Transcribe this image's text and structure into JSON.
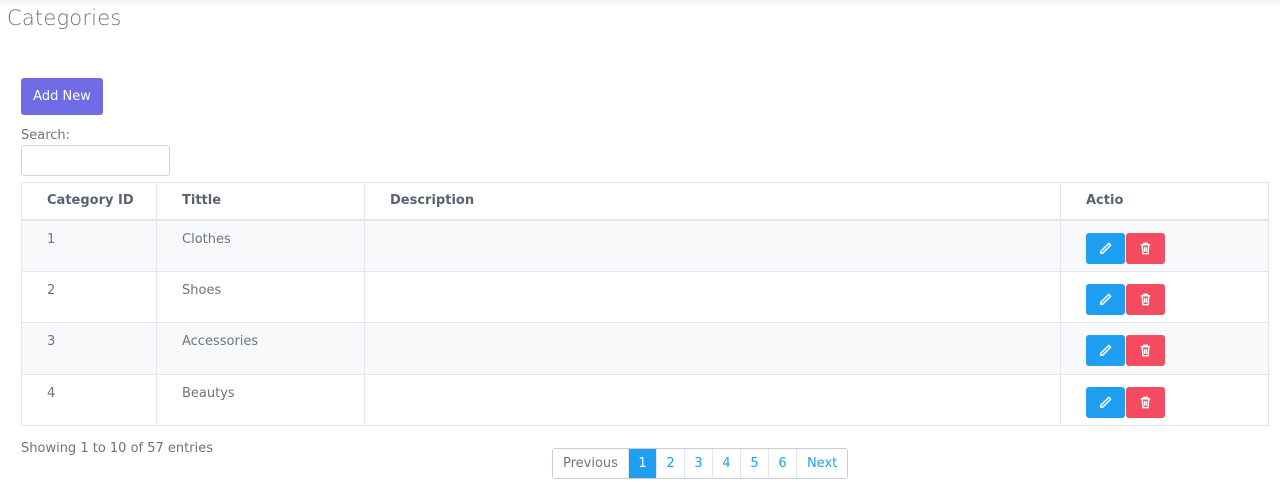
{
  "page": {
    "title": "Categories"
  },
  "toolbar": {
    "add_label": "Add New"
  },
  "search": {
    "label": "Search:",
    "value": "",
    "placeholder": ""
  },
  "table": {
    "headers": [
      "Category ID",
      "Tittle",
      "Description",
      "Actio"
    ],
    "rows": [
      {
        "id": "1",
        "title": "Clothes",
        "description": ""
      },
      {
        "id": "2",
        "title": "Shoes",
        "description": ""
      },
      {
        "id": "3",
        "title": "Accessories",
        "description": ""
      },
      {
        "id": "4",
        "title": "Beautys",
        "description": ""
      }
    ],
    "actions": {
      "edit_icon": "pencil-icon",
      "delete_icon": "trash-icon"
    }
  },
  "footer": {
    "info": "Showing 1 to 10 of 57 entries",
    "pagination": {
      "previous": "Previous",
      "pages": [
        "1",
        "2",
        "3",
        "4",
        "5",
        "6"
      ],
      "active": "1",
      "next": "Next"
    }
  },
  "colors": {
    "primary": "#6f6ce6",
    "info": "#1e9ff2",
    "danger": "#f34b5f"
  }
}
